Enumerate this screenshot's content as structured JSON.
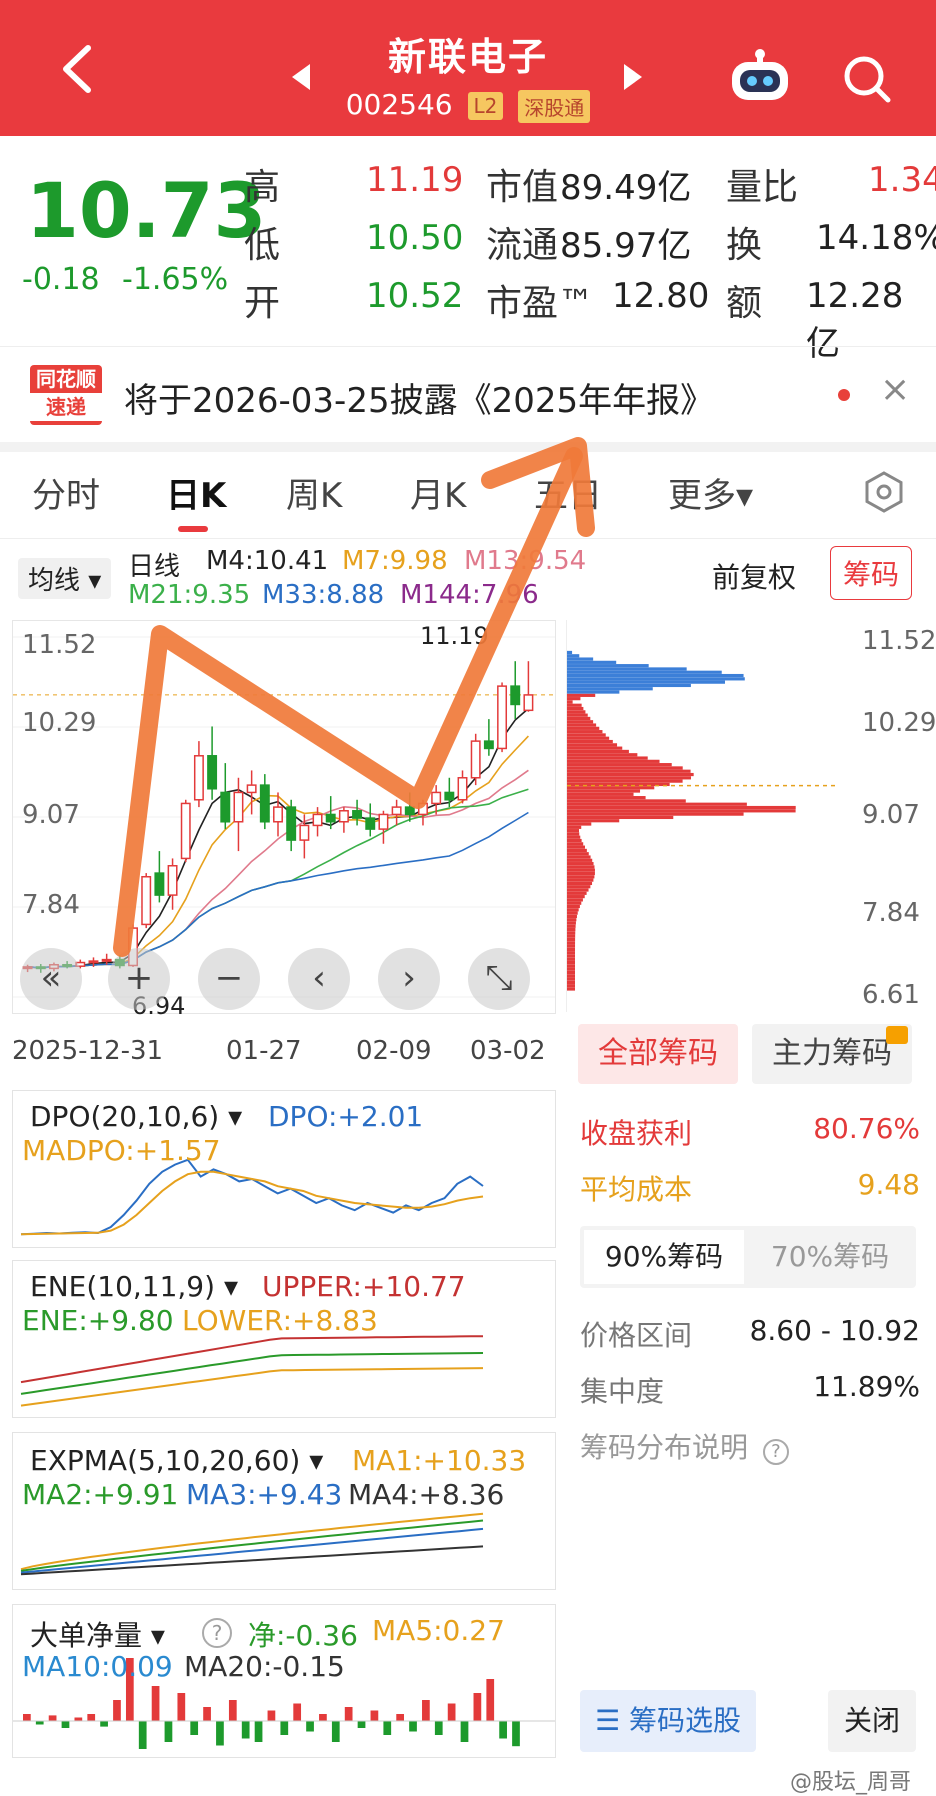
{
  "header": {
    "back_icon": "chevron-left-icon",
    "stock_name": "新联电子",
    "stock_code": "002546",
    "tag_l2": "L2",
    "tag_connect": "深股通",
    "prev_icon": "triangle-left-icon",
    "next_icon": "triangle-right-icon",
    "robot_icon": "robot-icon",
    "search_icon": "search-icon"
  },
  "quote": {
    "price": "10.73",
    "change": "-0.18",
    "change_pct": "-1.65%",
    "high_label": "高",
    "high": "11.19",
    "low_label": "低",
    "low": "10.50",
    "open_label": "开",
    "open": "10.52",
    "mktcap_label": "市值",
    "mktcap": "89.49亿",
    "float_label": "流通",
    "float": "85.97亿",
    "pe_label": "市盈™",
    "pe": "12.80",
    "volratio_label": "量比",
    "volratio": "1.34",
    "turnover_label": "换",
    "turnover": "14.18%",
    "amount_label": "额",
    "amount": "12.28亿"
  },
  "news": {
    "logo_top": "同花顺",
    "logo_bottom": "速递",
    "text": "将于2026-03-25披露《2025年年报》",
    "close_label": "×"
  },
  "tabs": [
    "分时",
    "日K",
    "周K",
    "月K",
    "五日",
    "更多▾"
  ],
  "settings_icon": "hexagon-gear-icon",
  "kline": {
    "ma_selector": "均线 ▾",
    "period": "日线",
    "m4": "M4:10.41",
    "m7": "M7:9.98",
    "m13": "M13:9.54",
    "m21": "M21:9.35",
    "m33": "M33:8.88",
    "m144": "M144:7.96",
    "adjust": "前复权",
    "chip_button": "筹码",
    "y_ticks": [
      "11.52",
      "10.29",
      "9.07",
      "7.84",
      "6.61"
    ],
    "x_ticks": [
      "2025-12-31",
      "01-27",
      "02-09",
      "03-02"
    ],
    "high_mark": "11.19",
    "low_mark": "6.94",
    "nav": [
      "«",
      "+",
      "−",
      "‹",
      "›",
      "⤡"
    ]
  },
  "chart_data": {
    "type": "candlestick",
    "y_range": [
      6.61,
      11.52
    ],
    "x_labels": [
      "2025-12-31",
      "01-27",
      "02-09",
      "03-02"
    ],
    "ohlc": [
      [
        7.0,
        7.05,
        6.95,
        7.02
      ],
      [
        7.02,
        7.06,
        6.94,
        7.0
      ],
      [
        7.0,
        7.08,
        6.96,
        7.05
      ],
      [
        7.05,
        7.1,
        7.0,
        7.03
      ],
      [
        7.03,
        7.12,
        7.0,
        7.08
      ],
      [
        7.08,
        7.15,
        7.02,
        7.1
      ],
      [
        7.1,
        7.2,
        7.05,
        7.12
      ],
      [
        7.12,
        7.18,
        7.0,
        7.04
      ],
      [
        7.04,
        7.6,
        7.02,
        7.55
      ],
      [
        7.6,
        8.3,
        7.55,
        8.25
      ],
      [
        8.3,
        8.6,
        7.9,
        8.0
      ],
      [
        8.0,
        8.5,
        7.8,
        8.4
      ],
      [
        8.5,
        9.3,
        8.45,
        9.25
      ],
      [
        9.3,
        10.1,
        9.2,
        9.9
      ],
      [
        9.9,
        10.3,
        9.3,
        9.45
      ],
      [
        9.4,
        9.8,
        8.9,
        9.0
      ],
      [
        9.0,
        9.6,
        8.6,
        9.4
      ],
      [
        9.4,
        9.7,
        9.1,
        9.5
      ],
      [
        9.5,
        9.65,
        8.9,
        9.0
      ],
      [
        9.0,
        9.4,
        8.8,
        9.2
      ],
      [
        9.2,
        9.3,
        8.6,
        8.75
      ],
      [
        8.75,
        9.1,
        8.5,
        8.95
      ],
      [
        8.95,
        9.2,
        8.8,
        9.1
      ],
      [
        9.1,
        9.35,
        8.9,
        9.0
      ],
      [
        9.0,
        9.2,
        8.85,
        9.15
      ],
      [
        9.15,
        9.3,
        8.95,
        9.05
      ],
      [
        9.05,
        9.25,
        8.8,
        8.9
      ],
      [
        8.9,
        9.15,
        8.7,
        9.1
      ],
      [
        9.1,
        9.3,
        8.95,
        9.2
      ],
      [
        9.2,
        9.4,
        9.0,
        9.1
      ],
      [
        9.1,
        9.3,
        8.95,
        9.25
      ],
      [
        9.25,
        9.5,
        9.1,
        9.4
      ],
      [
        9.4,
        9.6,
        9.2,
        9.3
      ],
      [
        9.3,
        9.7,
        9.25,
        9.6
      ],
      [
        9.6,
        10.2,
        9.5,
        10.1
      ],
      [
        10.1,
        10.4,
        9.9,
        10.0
      ],
      [
        10.0,
        10.9,
        9.95,
        10.85
      ],
      [
        10.85,
        11.19,
        10.4,
        10.6
      ],
      [
        10.52,
        11.19,
        10.5,
        10.73
      ]
    ],
    "ma_series": [
      {
        "name": "M4",
        "color": "#222222"
      },
      {
        "name": "M7",
        "color": "#e6a11d"
      },
      {
        "name": "M13",
        "color": "#e07a8c"
      },
      {
        "name": "M21",
        "color": "#3bb04a"
      },
      {
        "name": "M33",
        "color": "#2a6ec4"
      }
    ]
  },
  "chips": {
    "y_ticks": [
      "11.52",
      "10.29",
      "9.07",
      "7.84",
      "6.61"
    ],
    "all_label": "全部筹码",
    "main_label": "主力筹码",
    "profit_label": "收盘获利",
    "profit": "80.76%",
    "avgcost_label": "平均成本",
    "avgcost": "9.48",
    "p90_label": "90%筹码",
    "p70_label": "70%筹码",
    "range_label": "价格区间",
    "range": "8.60 - 10.92",
    "concentration_label": "集中度",
    "concentration": "11.89%",
    "explain_label": "筹码分布说明",
    "select_button": "筹码选股",
    "close_button": "关闭"
  },
  "indicators": {
    "dpo": {
      "name": "DPO(20,10,6) ▾",
      "dpo": "DPO:+2.01",
      "madpo": "MADPO:+1.57"
    },
    "ene": {
      "name": "ENE(10,11,9) ▾",
      "upper": "UPPER:+10.77",
      "ene": "ENE:+9.80",
      "lower": "LOWER:+8.83"
    },
    "expma": {
      "name": "EXPMA(5,10,20,60) ▾",
      "ma1": "MA1:+10.33",
      "ma2": "MA2:+9.91",
      "ma3": "MA3:+9.43",
      "ma4": "MA4:+8.36"
    },
    "bigorder": {
      "name": "大单净量 ▾",
      "net": "净:-0.36",
      "ma5": "MA5:0.27",
      "ma10": "MA10:0.09",
      "ma20": "MA20:-0.15"
    }
  },
  "watermark": "@股坛_周哥"
}
